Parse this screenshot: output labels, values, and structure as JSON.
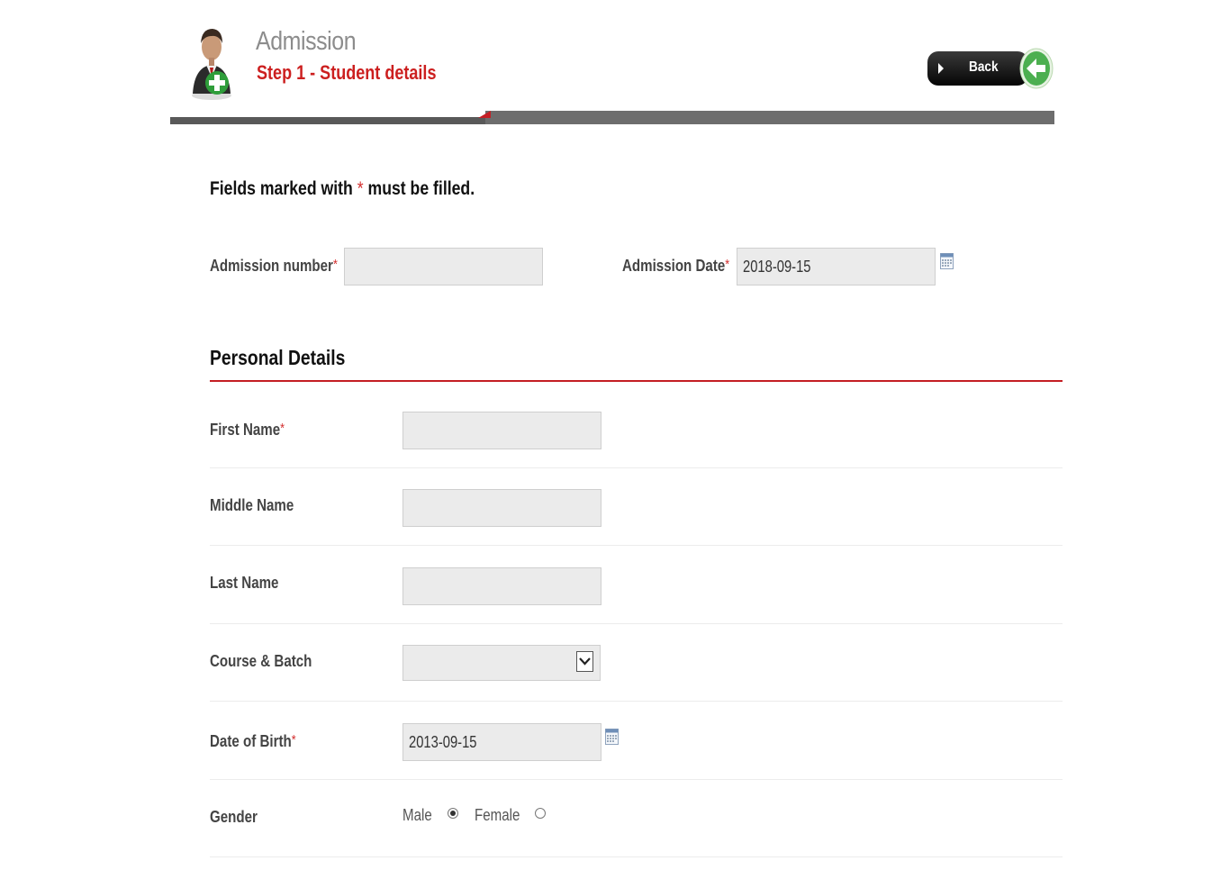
{
  "header": {
    "title": "Admission",
    "step": "Step 1 - Student details",
    "back_label": "Back"
  },
  "required_note": {
    "before": "Fields marked with",
    "star": "*",
    "after": "must be filled."
  },
  "admission": {
    "number_label": "Admission number",
    "number_value": "",
    "date_label": "Admission Date",
    "date_value": "2018-09-15"
  },
  "personal": {
    "section_title": "Personal Details",
    "first_name_label": "First Name",
    "middle_name_label": "Middle Name",
    "last_name_label": "Last Name",
    "course_batch_label": "Course & Batch",
    "course_batch_value": "",
    "dob_label": "Date of Birth",
    "dob_value": "2013-09-15",
    "gender_label": "Gender",
    "gender_options": [
      "Male",
      "Female"
    ],
    "gender_selected": "Male"
  },
  "colors": {
    "accent_red": "#c41e24",
    "header_bar": "#6d6d6d",
    "field_bg": "#ebebeb",
    "back_button_green": "#4caf50"
  },
  "icons": {
    "header": "student-add-icon",
    "back": "back-arrow-icon",
    "calendar": "calendar-icon",
    "dropdown": "chevron-down-icon"
  }
}
